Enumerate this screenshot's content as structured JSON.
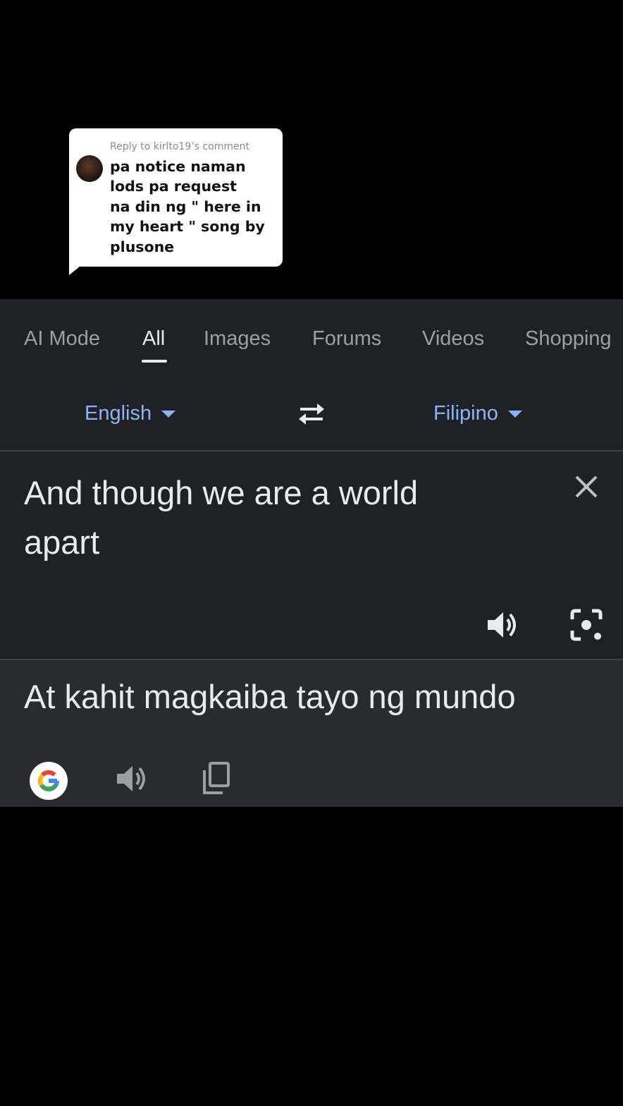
{
  "reply": {
    "header": "Reply to kirlto19’s comment",
    "comment_lines": [
      "pa notice naman",
      "lods pa request",
      "na din ng \" here in",
      "my heart \" song by",
      "plusone"
    ]
  },
  "search_tabs": [
    "AI Mode",
    "All",
    "Images",
    "Forums",
    "Videos",
    "Shopping"
  ],
  "active_tab": "All",
  "translate": {
    "source_language": "English",
    "target_language": "Filipino",
    "source_text_lines": [
      "And though we are a world",
      "apart"
    ],
    "translated_text": "At kahit magkaiba tayo ng mundo"
  },
  "icons": {
    "swap": "swap-icon",
    "close": "close-icon",
    "speaker": "speaker-icon",
    "lens": "lens-icon",
    "google": "google-logo-icon",
    "copy": "copy-icon"
  },
  "colors": {
    "panel_bg": "#202124",
    "accent": "#8ab4f8",
    "text": "#e8eaed",
    "muted": "#9aa0a6"
  }
}
